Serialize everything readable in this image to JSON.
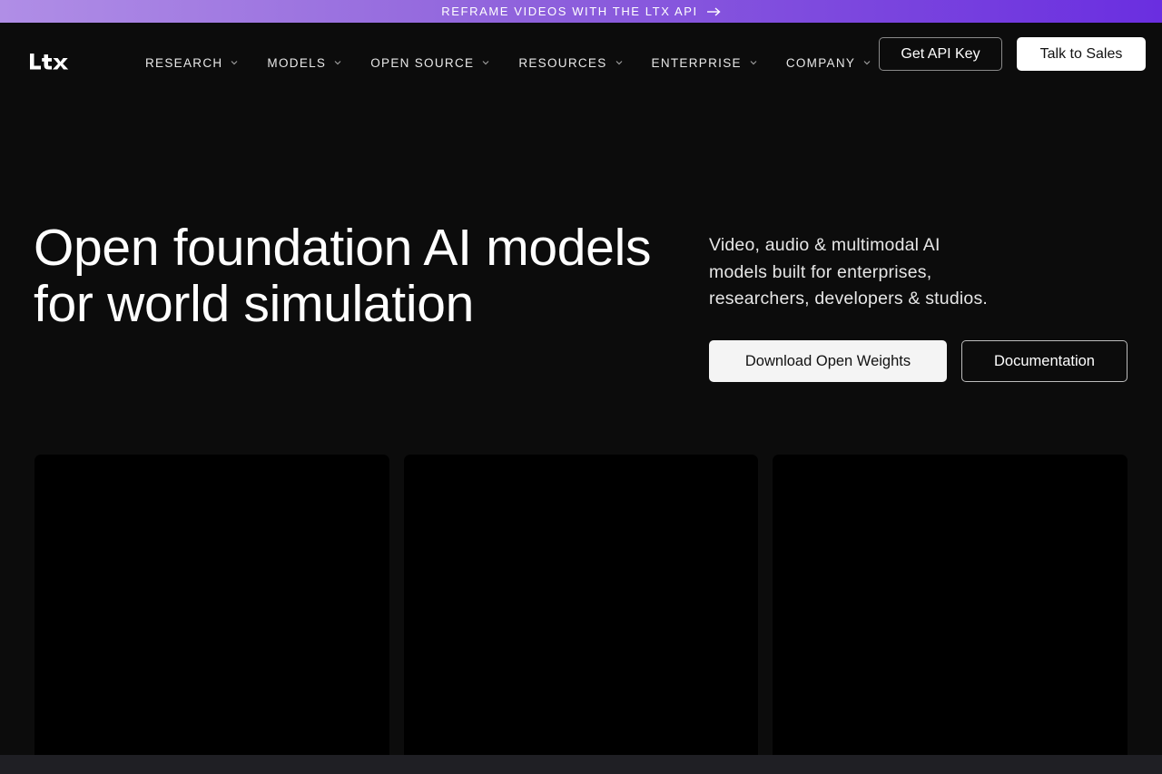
{
  "banner": {
    "text": "REFRAME VIDEOS WITH THE LTX API",
    "icon": "arrow-right-icon"
  },
  "header": {
    "logo_text": "LTX",
    "nav": [
      {
        "label": "RESEARCH",
        "icon": "chevron-down-icon"
      },
      {
        "label": "MODELS",
        "icon": "chevron-down-icon"
      },
      {
        "label": "OPEN SOURCE",
        "icon": "chevron-down-icon"
      },
      {
        "label": "RESOURCES",
        "icon": "chevron-down-icon"
      },
      {
        "label": "ENTERPRISE",
        "icon": "chevron-down-icon"
      },
      {
        "label": "COMPANY",
        "icon": "chevron-down-icon"
      }
    ],
    "api_button": "Get API Key",
    "sales_button": "Talk to Sales"
  },
  "hero": {
    "title_line1": "Open foundation AI models",
    "title_line2": "for world simulation",
    "subtitle_line1": "Video, audio & multimodal AI",
    "subtitle_line2": "models built for enterprises,",
    "subtitle_line3": "researchers, developers & studios.",
    "primary_button": "Download Open Weights",
    "secondary_button": "Documentation"
  },
  "colors": {
    "background": "#0c0c0c",
    "banner_start": "#b08ee6",
    "banner_end": "#6a2ee0",
    "card": "#000000",
    "bottom_strip": "#1f1f24"
  }
}
